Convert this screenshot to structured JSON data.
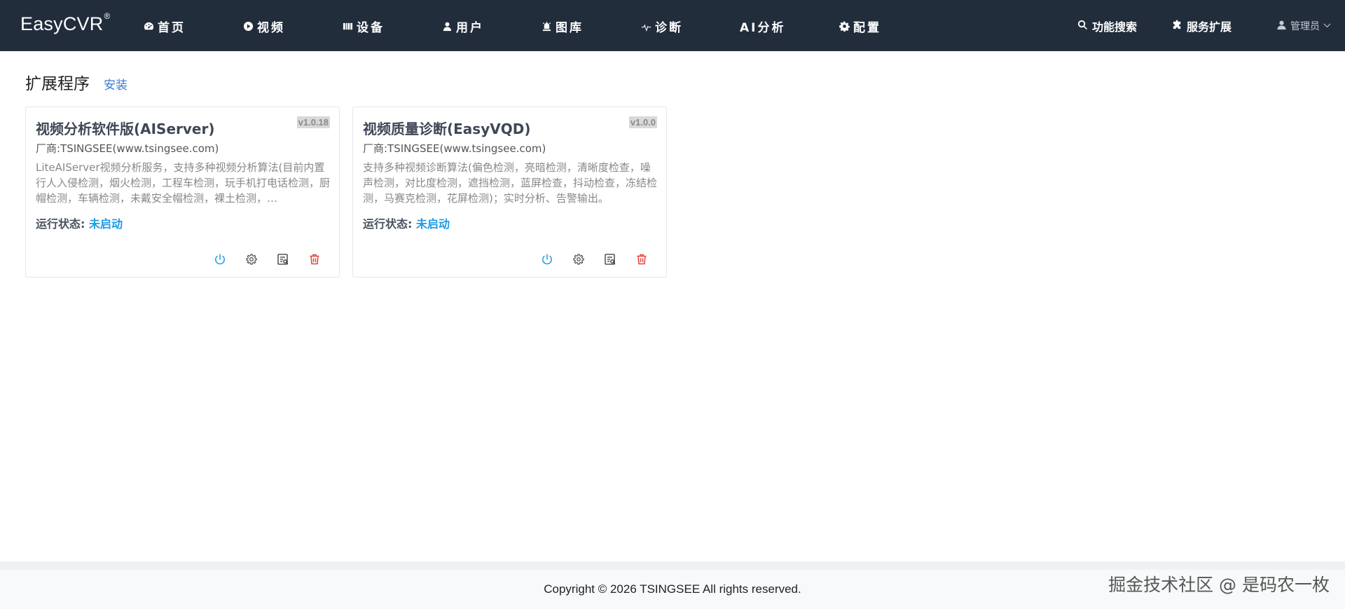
{
  "brand": {
    "name": "EasyCVR",
    "mark": "®"
  },
  "nav": {
    "items": [
      {
        "label": "首页",
        "icon": "dashboard-icon"
      },
      {
        "label": "视频",
        "icon": "play-circle-icon"
      },
      {
        "label": "设备",
        "icon": "device-icon"
      },
      {
        "label": "用户",
        "icon": "user-icon"
      },
      {
        "label": "图库",
        "icon": "image-library-icon"
      },
      {
        "label": "诊断",
        "icon": "pulse-icon"
      },
      {
        "label": "AI分析",
        "icon": ""
      },
      {
        "label": "配置",
        "icon": "gear-icon"
      }
    ],
    "search_label": "功能搜索",
    "services_label": "服务扩展",
    "user_label": "管理员"
  },
  "page": {
    "title": "扩展程序",
    "install_label": "安装"
  },
  "cards": [
    {
      "title": "视频分析软件版(AIServer)",
      "version": "v1.0.18",
      "vendor": "厂商:TSINGSEE(www.tsingsee.com)",
      "description": "LiteAIServer视频分析服务，支持多种视频分析算法(目前内置行人入侵检测，烟火检测，工程车检测，玩手机打电话检测，厨帽检测，车辆检测，未戴安全帽检测，裸土检测，…",
      "status_label": "运行状态:",
      "status_value": "未启动"
    },
    {
      "title": "视频质量诊断(EasyVQD)",
      "version": "v1.0.0",
      "vendor": "厂商:TSINGSEE(www.tsingsee.com)",
      "description": "支持多种视频诊断算法(偏色检测，亮暗检测，清晰度检查，噪声检测，对比度检测，遮挡检测，蓝屏检查，抖动检查，冻结检测，马赛克检测，花屏检测)；实时分析、告警输出。",
      "status_label": "运行状态:",
      "status_value": "未启动"
    }
  ],
  "footer": {
    "copyright": "Copyright © 2026 TSINGSEE All rights reserved.",
    "watermark": "掘金技术社区 @ 是码农一枚"
  },
  "colors": {
    "navbar_bg": "#222d3c",
    "accent_link": "#3a7bd5",
    "status_blue": "#1e9be6",
    "delete_red": "#e0443a"
  }
}
